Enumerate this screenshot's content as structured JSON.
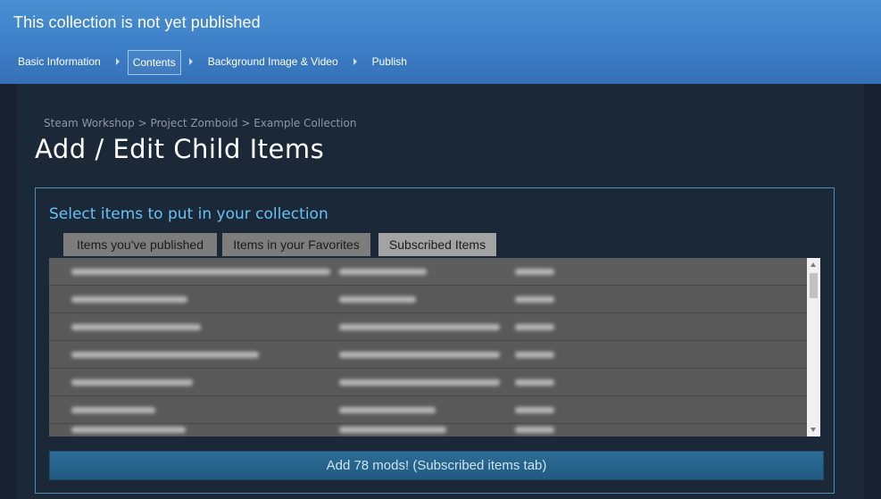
{
  "banner": {
    "title": "This collection is not yet published",
    "steps": [
      {
        "label": "Basic Information",
        "active": false
      },
      {
        "label": "Contents",
        "active": true
      },
      {
        "label": "Background Image & Video",
        "active": false
      },
      {
        "label": "Publish",
        "active": false
      }
    ]
  },
  "breadcrumb": {
    "items": [
      "Steam Workshop",
      "Project Zomboid",
      "Example Collection"
    ],
    "separator": ">"
  },
  "page": {
    "title": "Add / Edit Child Items"
  },
  "panel": {
    "title": "Select items to put in your collection",
    "tabs": [
      {
        "label": "Items you've published",
        "active": false
      },
      {
        "label": "Items in your Favorites",
        "active": false
      },
      {
        "label": "Subscribed Items",
        "active": true
      }
    ],
    "add_button_label": "Add 78 mods! (Subscribed items tab)"
  },
  "colors": {
    "banner_blue": "#3c7fc8",
    "title_blue": "#67c1f5",
    "page_bg": "#1b2838",
    "button_blue": "#2b6d97"
  }
}
